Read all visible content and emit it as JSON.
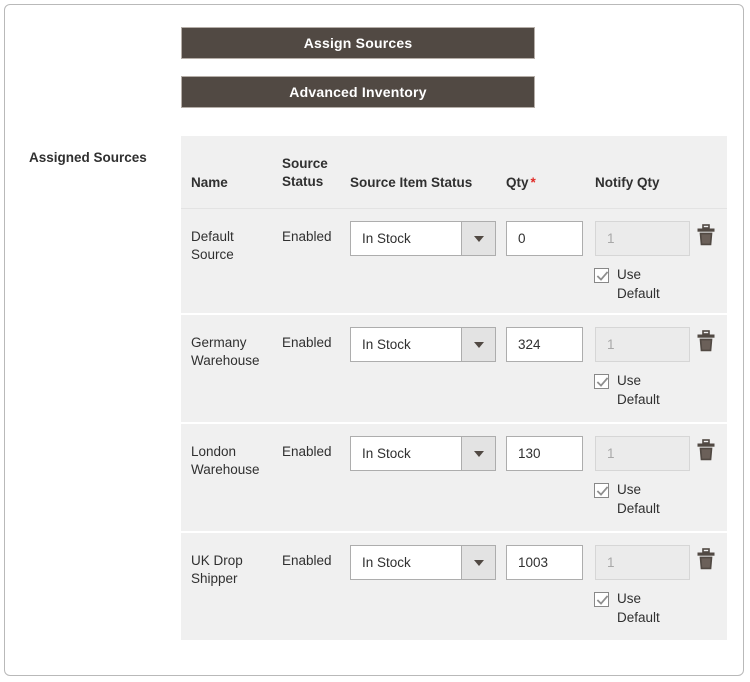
{
  "buttons": {
    "assign_sources": "Assign Sources",
    "advanced_inventory": "Advanced Inventory"
  },
  "field_label": "Assigned Sources",
  "table": {
    "columns": {
      "name": "Name",
      "source_status": "Source Status",
      "source_item_status": "Source Item Status",
      "qty": "Qty",
      "qty_required_marker": "*",
      "notify_qty": "Notify Qty"
    },
    "rows": [
      {
        "name": "Default Source",
        "source_status": "Enabled",
        "source_item_status": "In Stock",
        "qty": "0",
        "notify_qty": "1",
        "use_default_label": "Use Default",
        "use_default_checked": true,
        "delete_icon": "trash-icon"
      },
      {
        "name": "Germany Warehouse",
        "source_status": "Enabled",
        "source_item_status": "In Stock",
        "qty": "324",
        "notify_qty": "1",
        "use_default_label": "Use Default",
        "use_default_checked": true,
        "delete_icon": "trash-icon"
      },
      {
        "name": "London Warehouse",
        "source_status": "Enabled",
        "source_item_status": "In Stock",
        "qty": "130",
        "notify_qty": "1",
        "use_default_label": "Use Default",
        "use_default_checked": true,
        "delete_icon": "trash-icon"
      },
      {
        "name": "UK Drop Shipper",
        "source_status": "Enabled",
        "source_item_status": "In Stock",
        "qty": "1003",
        "notify_qty": "1",
        "use_default_label": "Use Default",
        "use_default_checked": true,
        "delete_icon": "trash-icon"
      }
    ]
  },
  "colors": {
    "button_bg": "#514943",
    "required_asterisk": "#e02b27",
    "table_bg": "#f0f0f0",
    "text": "#303030",
    "disabled_text": "#a8a8a8"
  }
}
